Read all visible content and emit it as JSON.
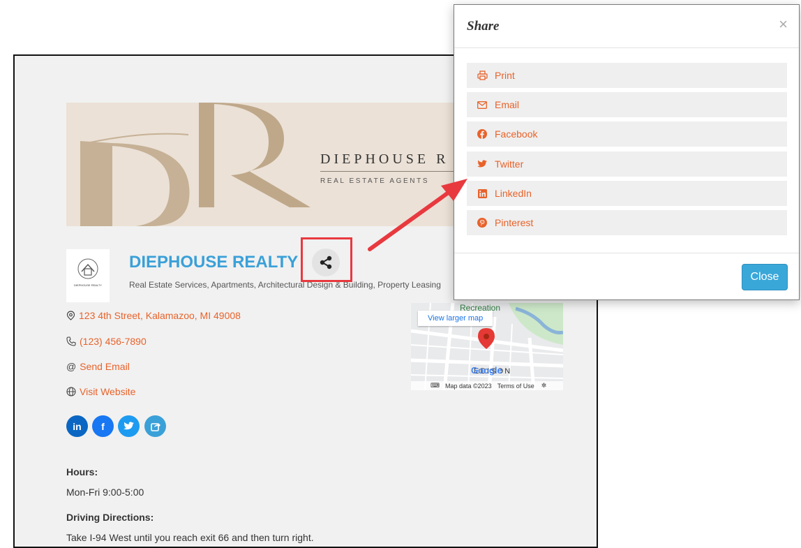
{
  "banner": {
    "monogram": "DR",
    "brand_name": "DIEPHOUSE R",
    "brand_tagline": "REAL ESTATE AGENTS",
    "logo_thumb_text": "DIEPHOUSE REALTY"
  },
  "listing": {
    "name": "DIEPHOUSE REALTY",
    "categories": "Real Estate Services, Apartments, Architectural Design & Building, Property Leasing",
    "address": "123 4th Street, Kalamazoo, MI 49008",
    "phone": "(123) 456-7890",
    "email_link": "Send Email",
    "website_link": "Visit Website",
    "hours_label": "Hours:",
    "hours_text": "Mon-Fri 9:00-5:00",
    "directions_label": "Driving Directions:",
    "directions_text": "Take I-94 West until you reach exit 66 and then turn right."
  },
  "social": {
    "linkedin": "in",
    "facebook": "f"
  },
  "map": {
    "place_label": "Recreation",
    "larger_map_link": "View larger map",
    "area_label": "EDISON",
    "google_logo": "Google",
    "attribution": "Map data ©2023",
    "terms_link": "Terms of Use"
  },
  "modal": {
    "title": "Share",
    "close_x": "×",
    "items": [
      {
        "label": "Print",
        "icon": "printer-icon"
      },
      {
        "label": "Email",
        "icon": "envelope-icon"
      },
      {
        "label": "Facebook",
        "icon": "facebook-icon"
      },
      {
        "label": "Twitter",
        "icon": "twitter-icon"
      },
      {
        "label": "LinkedIn",
        "icon": "linkedin-icon"
      },
      {
        "label": "Pinterest",
        "icon": "pinterest-icon"
      }
    ],
    "close_button": "Close"
  },
  "colors": {
    "accent_orange": "#e8622a",
    "link_blue": "#3aa0d8",
    "annotation_red": "#e8393f",
    "button_blue": "#3aa7d9"
  }
}
